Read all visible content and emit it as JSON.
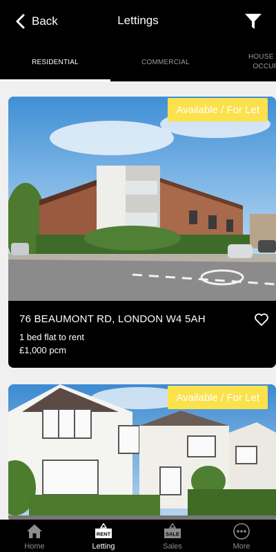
{
  "header": {
    "back_label": "Back",
    "title": "Lettings",
    "filter_icon": "filter-icon"
  },
  "tabs": [
    {
      "label": "RESIDENTIAL",
      "active": true
    },
    {
      "label": "COMMERCIAL",
      "active": false
    },
    {
      "label": "HOUSE IN OCCUP",
      "active": false
    }
  ],
  "listings": [
    {
      "badge": "Available / For Let",
      "address": "76 BEAUMONT RD, LONDON W4 5AH",
      "description": "1 bed flat to rent",
      "price": "£1,000 pcm",
      "photo": "modern-flats-building-photo"
    },
    {
      "badge": "Available / For Let",
      "photo": "semi-detached-houses-photo"
    }
  ],
  "bottom_nav": [
    {
      "label": "Home",
      "icon": "home-icon",
      "active": false
    },
    {
      "label": "Letting",
      "icon": "rent-sign-icon",
      "icon_text": "RENT",
      "active": true
    },
    {
      "label": "Sales",
      "icon": "sale-sign-icon",
      "icon_text": "SALE",
      "active": false
    },
    {
      "label": "More",
      "icon": "more-icon",
      "active": false
    }
  ],
  "colors": {
    "header_bg": "#000000",
    "page_bg": "#f0f0f0",
    "badge_bg": "#fbe14b",
    "inactive_text": "#9a9a9a"
  }
}
